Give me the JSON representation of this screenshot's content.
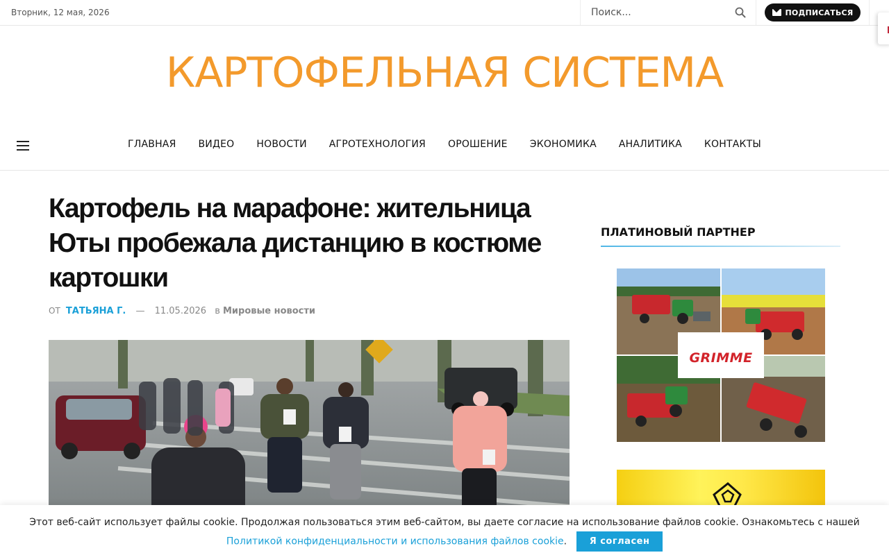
{
  "topbar": {
    "date": "Вторник, 12 мая, 2026",
    "search_placeholder": "Поиск...",
    "subscribe_label": "ПОДПИСАТЬСЯ"
  },
  "site": {
    "title": "КАРТОФЕЛЬНАЯ СИСТЕМА",
    "title_color": "#f39a2c"
  },
  "nav": {
    "items": [
      "ГЛАВНАЯ",
      "ВИДЕО",
      "НОВОСТИ",
      "АГРОТЕХНОЛОГИЯ",
      "ОРОШЕНИЕ",
      "ЭКОНОМИКА",
      "АНАЛИТИКА",
      "КОНТАКТЫ"
    ]
  },
  "article": {
    "headline": "Картофель на марафоне: жительница Юты пробежала дистанцию в костюме картошки",
    "by_label": "ОТ",
    "author": "ТАТЬЯНА Г.",
    "dash": "—",
    "date": "11.05.2026",
    "in_label": "в",
    "category": "Мировые новости"
  },
  "sidebar": {
    "widget_title": "ПЛАТИНОВЫЙ ПАРТНЕР",
    "partner_logo": "GRIMME"
  },
  "cookie": {
    "text": "Этот веб-сайт использует файлы cookie. Продолжая пользоваться этим веб-сайтом, вы даете согласие на использование файлов cookie. Ознакомьтесь с нашей ",
    "link": "Политикой конфиденциальности и использования файлов cookie",
    "period": ".",
    "button": "Я согласен"
  },
  "colors": {
    "accent": "#1aa0d8",
    "logo": "#f39a2c",
    "partner_red": "#d2232a"
  }
}
